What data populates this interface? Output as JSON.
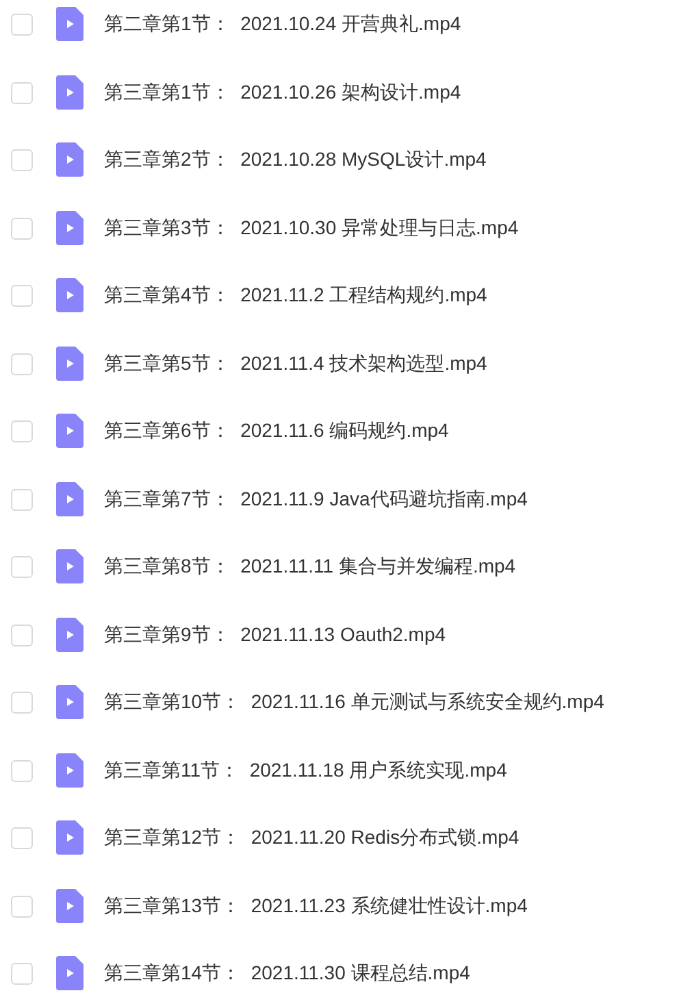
{
  "files": [
    {
      "name": "第二章第1节：  2021.10.24 开营典礼.mp4",
      "checked": false
    },
    {
      "name": "第三章第1节：  2021.10.26 架构设计.mp4",
      "checked": false
    },
    {
      "name": "第三章第2节：  2021.10.28 MySQL设计.mp4",
      "checked": false
    },
    {
      "name": "第三章第3节：  2021.10.30 异常处理与日志.mp4",
      "checked": false
    },
    {
      "name": "第三章第4节：  2021.11.2 工程结构规约.mp4",
      "checked": false
    },
    {
      "name": "第三章第5节：  2021.11.4 技术架构选型.mp4",
      "checked": false
    },
    {
      "name": "第三章第6节：  2021.11.6 编码规约.mp4",
      "checked": false
    },
    {
      "name": "第三章第7节：  2021.11.9 Java代码避坑指南.mp4",
      "checked": false
    },
    {
      "name": "第三章第8节：  2021.11.11 集合与并发编程.mp4",
      "checked": false
    },
    {
      "name": "第三章第9节：  2021.11.13 Oauth2.mp4",
      "checked": false
    },
    {
      "name": "第三章第10节：  2021.11.16 单元测试与系统安全规约.mp4",
      "checked": false
    },
    {
      "name": "第三章第11节：  2021.11.18 用户系统实现.mp4",
      "checked": false
    },
    {
      "name": "第三章第12节：  2021.11.20 Redis分布式锁.mp4",
      "checked": false
    },
    {
      "name": "第三章第13节：  2021.11.23 系统健壮性设计.mp4",
      "checked": false
    },
    {
      "name": "第三章第14节：  2021.11.30 课程总结.mp4",
      "checked": false
    }
  ]
}
